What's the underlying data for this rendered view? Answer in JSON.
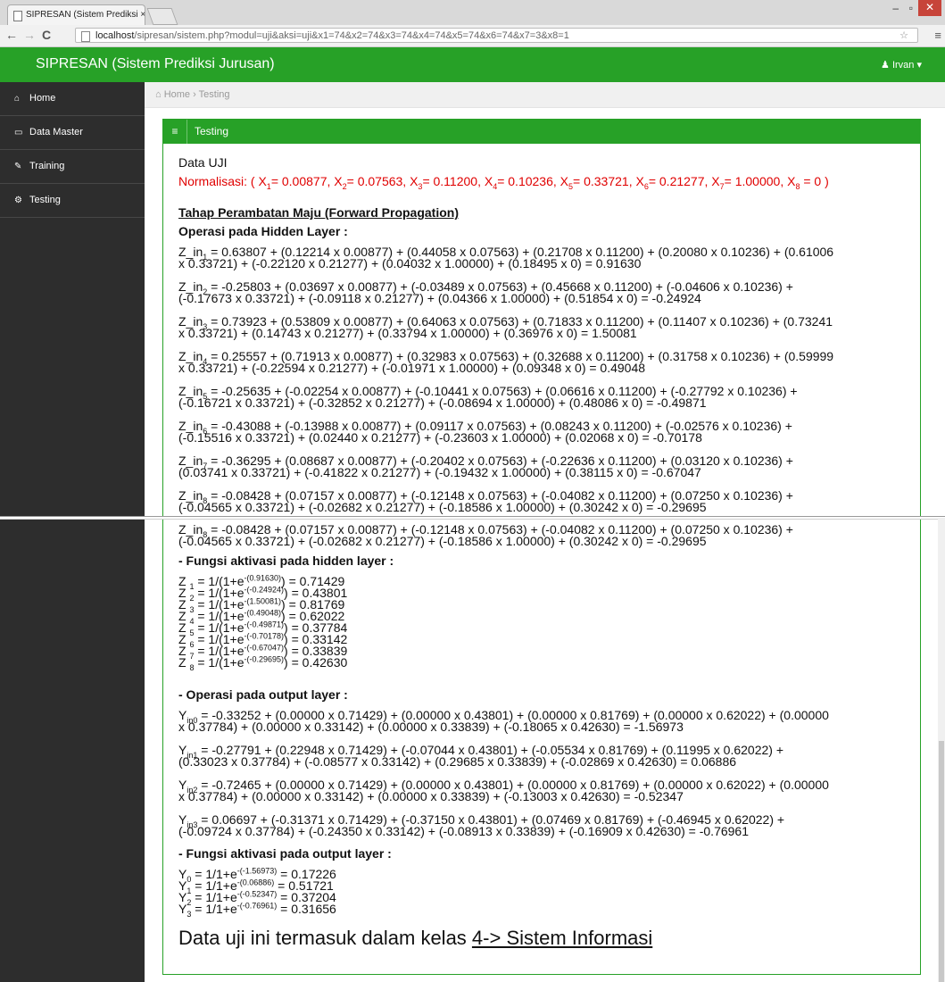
{
  "browser": {
    "tab_title": "SIPRESAN (Sistem Prediksi ×",
    "url_host": "localhost",
    "url_path": "/sipresan/sistem.php?modul=uji&aksi=uji&x1=74&x2=74&x3=74&x4=74&x5=74&x6=74&x7=3&x8=1"
  },
  "navbar": {
    "brand": "SIPRESAN (Sistem Prediksi Jurusan)",
    "user": "Irvan ▾"
  },
  "sidebar": {
    "items": [
      {
        "label": "Home",
        "icon": "home-icon"
      },
      {
        "label": "Data Master",
        "icon": "folder-icon"
      },
      {
        "label": "Training",
        "icon": "edit-icon"
      },
      {
        "label": "Testing",
        "icon": "cogs-icon"
      }
    ]
  },
  "breadcrumb": {
    "home": "Home",
    "sep": "›",
    "current": "Testing"
  },
  "panel": {
    "title": "Testing"
  },
  "content": {
    "data_uji": "Data UJI",
    "normalisasi": "Normalisasi: ( X1= 0.00877, X2= 0.07563, X3= 0.11200, X4= 0.10236, X5= 0.33721, X6= 0.21277, X7= 1.00000, X8 = 0 )",
    "forward_heading": "Tahap Perambatan Maju (Forward Propagation)",
    "hidden_heading": "Operasi pada Hidden Layer :",
    "z_in": [
      [
        "Z_in1 = 0.63807 + (0.12214 x 0.00877) + (0.44058 x 0.07563) + (0.21708 x 0.11200) + (0.20080 x 0.10236) + (0.61006",
        "x 0.33721) + (-0.22120 x 0.21277) + (0.04032 x 1.00000) + (0.18495 x 0) = 0.91630"
      ],
      [
        "Z_in2 = -0.25803 + (0.03697 x 0.00877) + (-0.03489 x 0.07563) + (0.45668 x 0.11200) + (-0.04606 x 0.10236) +",
        "(-0.17673 x 0.33721) + (-0.09118 x 0.21277) + (0.04366 x 1.00000) + (0.51854 x 0) = -0.24924"
      ],
      [
        "Z_in3 = 0.73923 + (0.53809 x 0.00877) + (0.64063 x 0.07563) + (0.71833 x 0.11200) + (0.11407 x 0.10236) + (0.73241",
        "x 0.33721) + (0.14743 x 0.21277) + (0.33794 x 1.00000) + (0.36976 x 0) = 1.50081"
      ],
      [
        "Z_in4 = 0.25557 + (0.71913 x 0.00877) + (0.32983 x 0.07563) + (0.32688 x 0.11200) + (0.31758 x 0.10236) + (0.59999",
        "x 0.33721) + (-0.22594 x 0.21277) + (-0.01971 x 1.00000) + (0.09348 x 0) = 0.49048"
      ],
      [
        "Z_in5 = -0.25635 + (-0.02254 x 0.00877) + (-0.10441 x 0.07563) + (0.06616 x 0.11200) + (-0.27792 x 0.10236) +",
        "(-0.16721 x 0.33721) + (-0.32852 x 0.21277) + (-0.08694 x 1.00000) + (0.48086 x 0) = -0.49871"
      ],
      [
        "Z_in6 = -0.43088 + (-0.13988 x 0.00877) + (0.09117 x 0.07563) + (0.08243 x 0.11200) + (-0.02576 x 0.10236) +",
        "(-0.15516 x 0.33721) + (0.02440 x 0.21277) + (-0.23603 x 1.00000) + (0.02068 x 0) = -0.70178"
      ],
      [
        "Z_in7 = -0.36295 + (0.08687 x 0.00877) + (-0.20402 x 0.07563) + (-0.22636 x 0.11200) + (0.03120 x 0.10236) +",
        "(0.03741 x 0.33721) + (-0.41822 x 0.21277) + (-0.19432 x 1.00000) + (0.38115 x 0) = -0.67047"
      ],
      [
        "Z_in8 = -0.08428 + (0.07157 x 0.00877) + (-0.12148 x 0.07563) + (-0.04082 x 0.11200) + (0.07250 x 0.10236) +",
        "(-0.04565 x 0.33721) + (-0.02682 x 0.21277) + (-0.18586 x 1.00000) + (0.30242 x 0) = -0.29695"
      ]
    ],
    "act_hidden_heading": "- Fungsi aktivasi pada hidden layer :",
    "z_act": [
      {
        "n": "1",
        "e": "(0.91630)",
        "v": "0.71429"
      },
      {
        "n": "2",
        "e": "(-0.24924)",
        "v": "0.43801"
      },
      {
        "n": "3",
        "e": "(1.50081)",
        "v": "0.81769"
      },
      {
        "n": "4",
        "e": "(0.49048)",
        "v": "0.62022"
      },
      {
        "n": "5",
        "e": "(-0.49871)",
        "v": "0.37784"
      },
      {
        "n": "6",
        "e": "(-0.70178)",
        "v": "0.33142"
      },
      {
        "n": "7",
        "e": "(-0.67047)",
        "v": "0.33839"
      },
      {
        "n": "8",
        "e": "(-0.29695)",
        "v": "0.42630"
      }
    ],
    "output_heading": "- Operasi pada output layer :",
    "y_in": [
      {
        "n": "in0",
        "l1": "= -0.33252 + (0.00000 x 0.71429) + (0.00000 x 0.43801) + (0.00000 x 0.81769) + (0.00000 x 0.62022) + (0.00000",
        "l2": "x 0.37784) + (0.00000 x 0.33142) + (0.00000 x 0.33839) + (-0.18065 x 0.42630) = -1.56973"
      },
      {
        "n": "in1",
        "l1": "= -0.27791 + (0.22948 x 0.71429) + (-0.07044 x 0.43801) + (-0.05534 x 0.81769) + (0.11995 x 0.62022) +",
        "l2": "(0.33023 x 0.37784) + (-0.08577 x 0.33142) + (0.29685 x 0.33839) + (-0.02869 x 0.42630) = 0.06886"
      },
      {
        "n": "in2",
        "l1": "= -0.72465 + (0.00000 x 0.71429) + (0.00000 x 0.43801) + (0.00000 x 0.81769) + (0.00000 x 0.62022) + (0.00000",
        "l2": "x 0.37784) + (0.00000 x 0.33142) + (0.00000 x 0.33839) + (-0.13003 x 0.42630) = -0.52347"
      },
      {
        "n": "in3",
        "l1": "= 0.06697 + (-0.31371 x 0.71429) + (-0.37150 x 0.43801) + (0.07469 x 0.81769) + (-0.46945 x 0.62022) +",
        "l2": "(-0.09724 x 0.37784) + (-0.24350 x 0.33142) + (-0.08913 x 0.33839) + (-0.16909 x 0.42630) = -0.76961"
      }
    ],
    "act_output_heading": "- Fungsi aktivasi pada output layer :",
    "y_act": [
      {
        "n": "0",
        "e": "(-1.56973)",
        "v": "0.17226"
      },
      {
        "n": "1",
        "e": "(0.06886)",
        "v": "0.51721"
      },
      {
        "n": "2",
        "e": "(-0.52347)",
        "v": "0.37204"
      },
      {
        "n": "3",
        "e": "(-0.76961)",
        "v": "0.31656"
      }
    ],
    "result_prefix": "Data uji ini termasuk dalam kelas ",
    "result_class": "4-> Sistem Informasi"
  }
}
